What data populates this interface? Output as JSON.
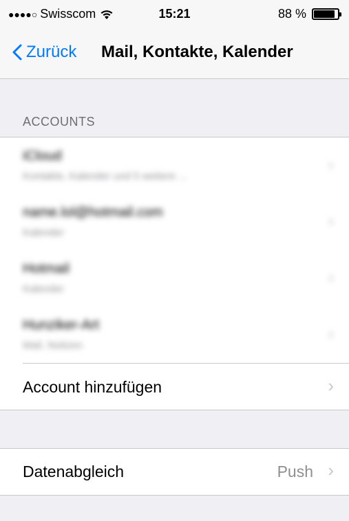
{
  "status_bar": {
    "signal": "●●●●○",
    "carrier": "Swisscom",
    "time": "15:21",
    "battery": "88 %",
    "battery_level": 0.88
  },
  "nav": {
    "back_label": "Zurück",
    "title": "Mail, Kontakte, Kalender"
  },
  "accounts": {
    "header": "ACCOUNTS",
    "items": [
      {
        "title": "iCloud",
        "subtitle": "Kontakte, Kalender und 5 weitere ..."
      },
      {
        "title": "name.lol@hotmail.com",
        "subtitle": "Kalender"
      },
      {
        "title": "Hotmail",
        "subtitle": "Kalender"
      },
      {
        "title": "Hunziker-Art",
        "subtitle": "Mail, Notizen"
      }
    ],
    "add_label": "Account hinzufügen"
  },
  "fetch": {
    "label": "Datenabgleich",
    "value": "Push"
  },
  "colors": {
    "accent": "#007aff",
    "background": "#efeff4"
  }
}
